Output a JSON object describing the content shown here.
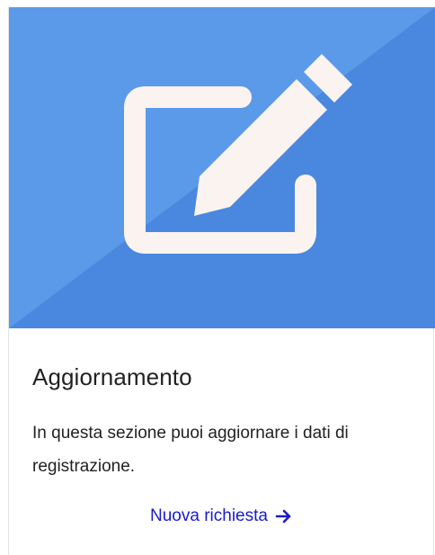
{
  "card": {
    "icon": "edit-icon",
    "title": "Aggiornamento",
    "description": "In questa sezione puoi aggiornare i dati di registrazione.",
    "cta_label": "Nuova richiesta",
    "cta_icon": "arrow-right-icon"
  },
  "colors": {
    "hero_light": "#5b9ae9",
    "hero_dark": "#4a88df",
    "icon": "#fbf3ef",
    "link": "#1a1acc",
    "text": "#222222"
  }
}
